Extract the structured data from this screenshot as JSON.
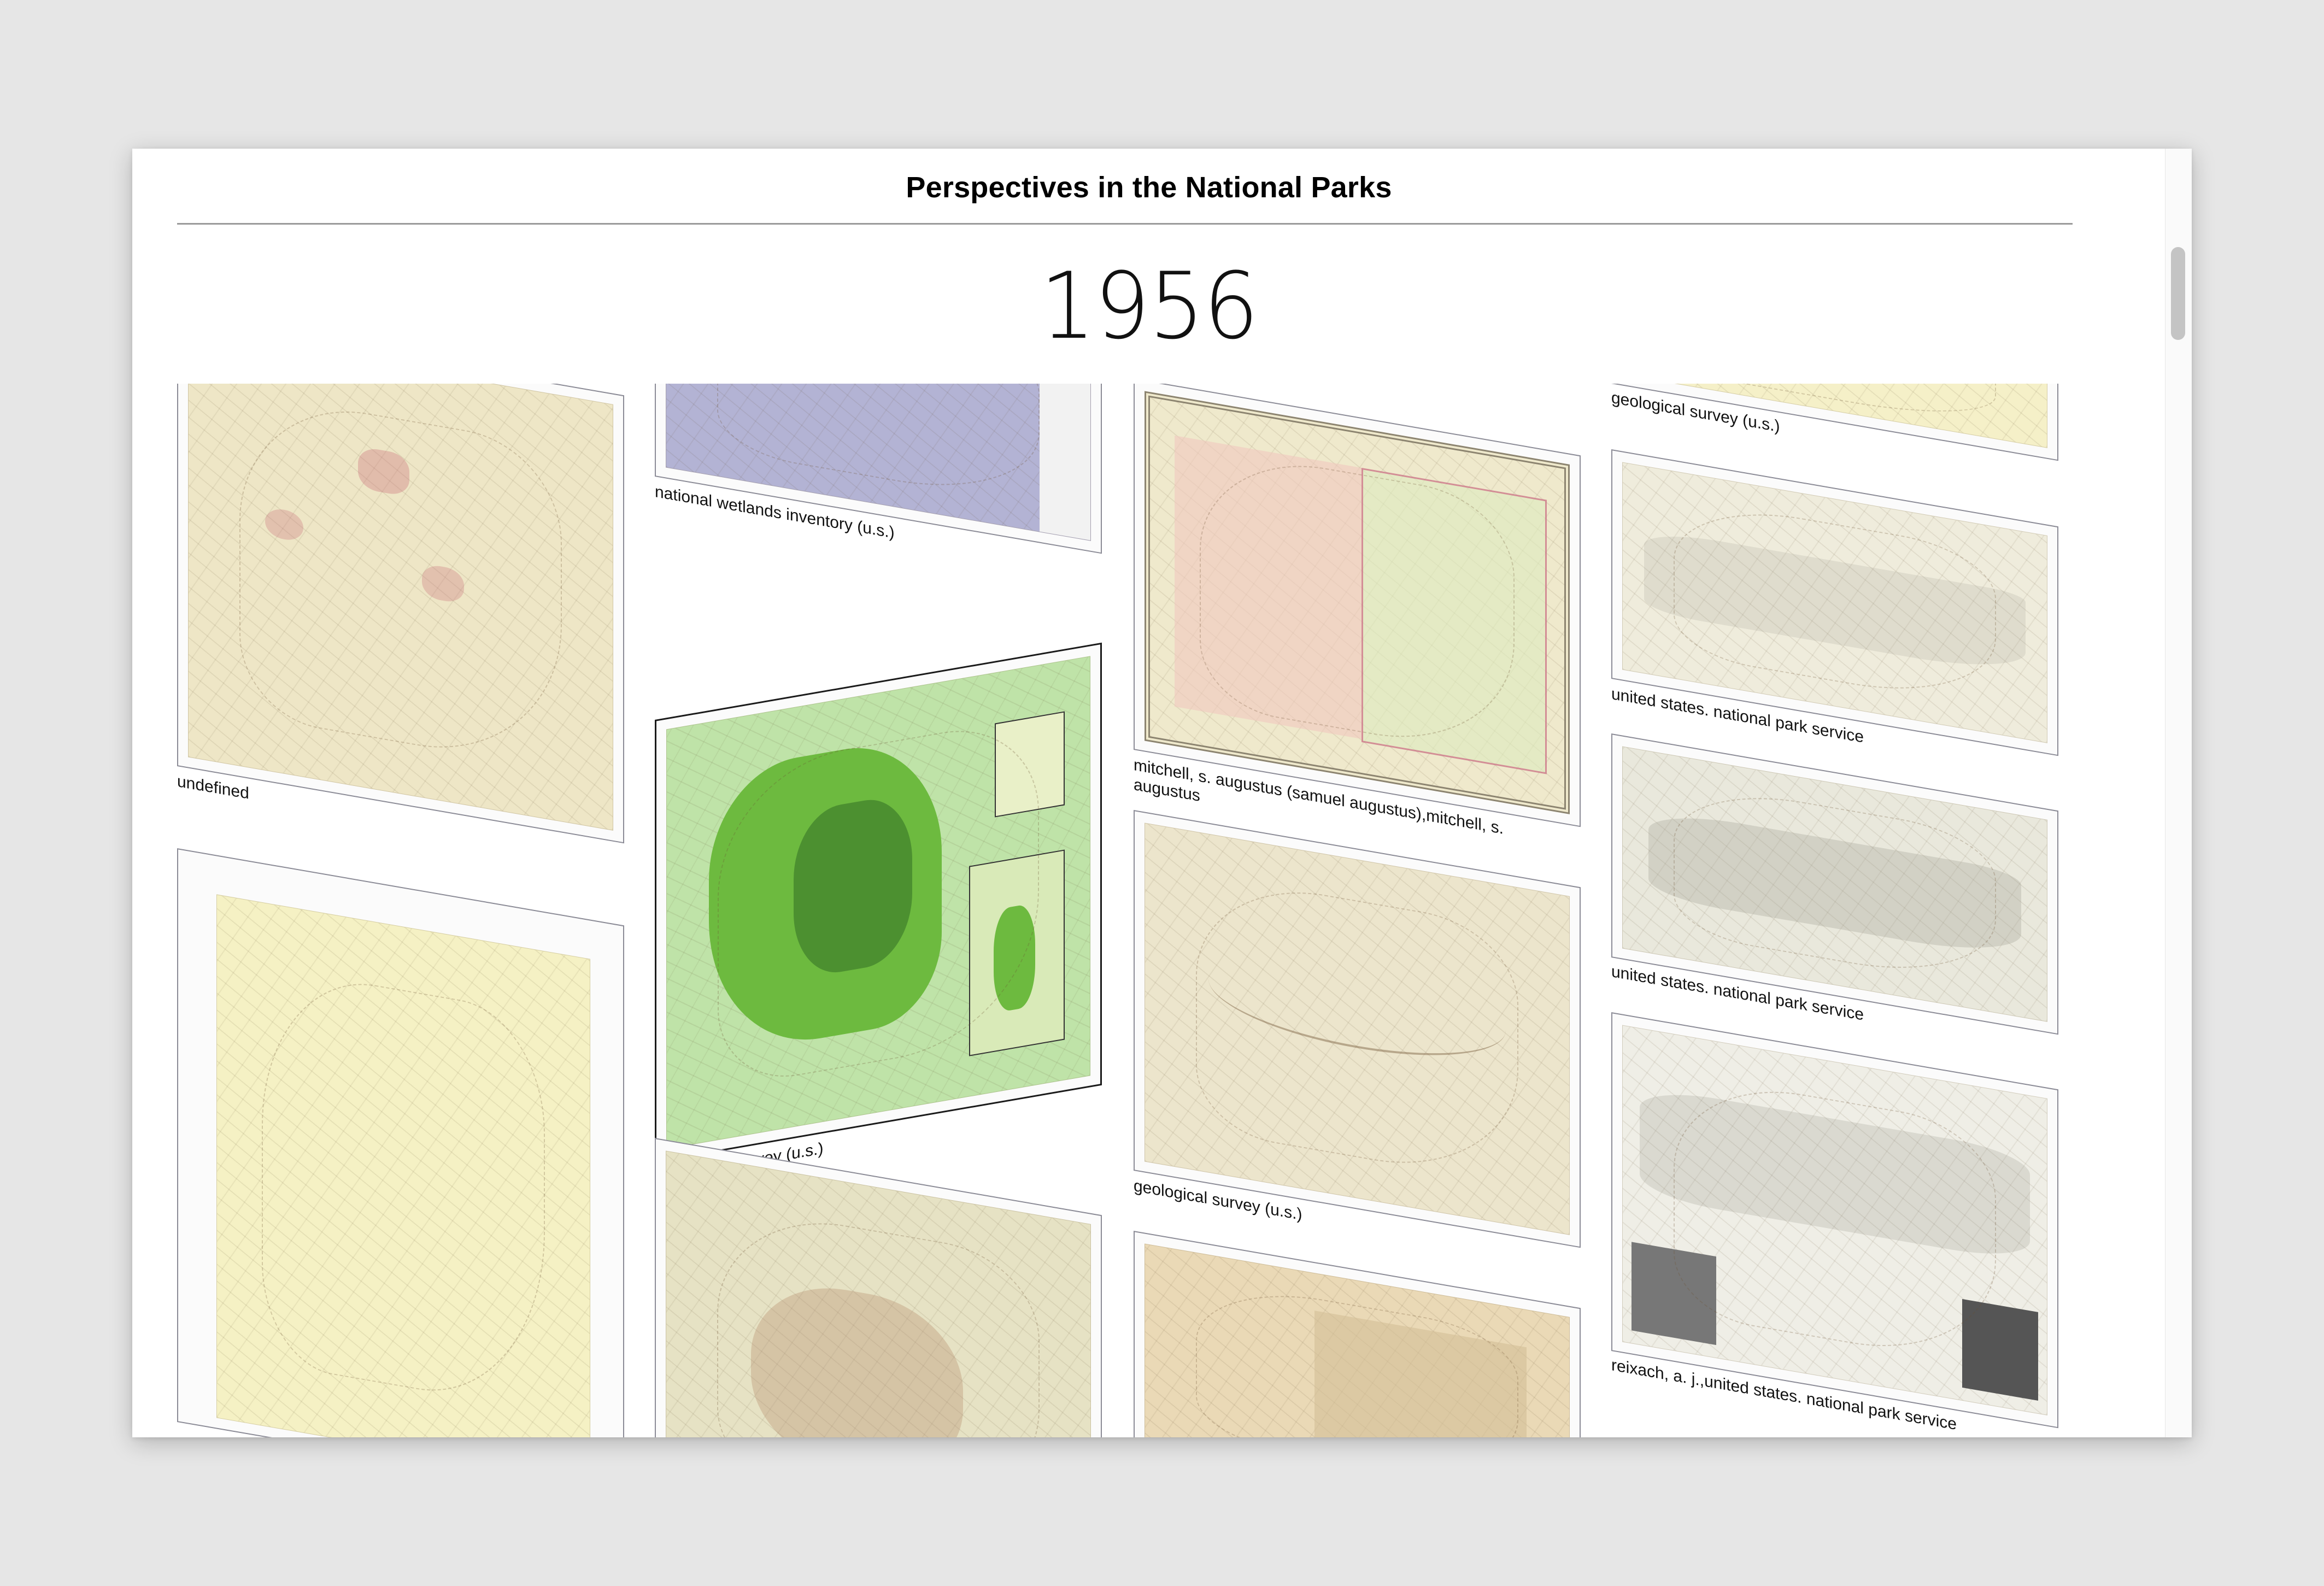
{
  "header": {
    "title": "Perspectives in the National Parks"
  },
  "year": "1956",
  "colors": {
    "selected_border": "#1a1a1a",
    "frame_border": "#8b8b96",
    "paper": "#efe8c8",
    "wetlands_blue": "#a6a6cc",
    "green_map": "#6dba3f"
  },
  "cards": [
    {
      "caption": "undefined",
      "style": "paper-pink"
    },
    {
      "caption": "national wetlands inventory (u.s.)",
      "style": "wetlands"
    },
    {
      "caption": "geological survey (u.s.)",
      "style": "green-island"
    },
    {
      "caption": "mitchell, s. augustus (samuel augustus),mitchell, s. augustus",
      "style": "arizona-nm"
    },
    {
      "caption": "geological survey (u.s.)",
      "style": "topo-canyon"
    },
    {
      "caption": "geological survey (u.s.)",
      "style": "paper-strip"
    },
    {
      "caption": "united states. national park service",
      "style": "smoky-1"
    },
    {
      "caption": "united states. national park service",
      "style": "smoky-2"
    },
    {
      "caption": "reixach, a. j.,united states. national park service",
      "style": "smoky-3"
    },
    {
      "caption": "",
      "style": "yellowstone"
    },
    {
      "caption": "",
      "style": "island-relief"
    },
    {
      "caption": "",
      "style": "territory-arizona"
    }
  ]
}
